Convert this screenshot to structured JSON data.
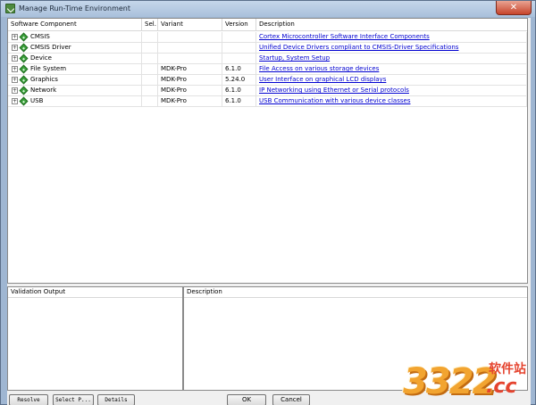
{
  "window": {
    "title": "Manage Run-Time Environment",
    "close_label": "✕"
  },
  "grid": {
    "columns": {
      "component": "Software Component",
      "sel": "Sel.",
      "variant": "Variant",
      "version": "Version",
      "description": "Description"
    },
    "rows": [
      {
        "expander": "+",
        "name": "CMSIS",
        "sel": "",
        "variant": "",
        "version": "",
        "description": "Cortex Microcontroller Software Interface Components"
      },
      {
        "expander": "+",
        "name": "CMSIS Driver",
        "sel": "",
        "variant": "",
        "version": "",
        "description": "Unified Device Drivers compliant to CMSIS-Driver Specifications"
      },
      {
        "expander": "+",
        "name": "Device",
        "sel": "",
        "variant": "",
        "version": "",
        "description": "Startup, System Setup"
      },
      {
        "expander": "+",
        "name": "File System",
        "sel": "",
        "variant": "MDK-Pro",
        "version": "6.1.0",
        "description": "File Access on various storage devices"
      },
      {
        "expander": "+",
        "name": "Graphics",
        "sel": "",
        "variant": "MDK-Pro",
        "version": "5.24.0",
        "description": "User Interface on graphical LCD displays"
      },
      {
        "expander": "+",
        "name": "Network",
        "sel": "",
        "variant": "MDK-Pro",
        "version": "6.1.0",
        "description": "IP Networking using Ethernet or Serial protocols"
      },
      {
        "expander": "+",
        "name": "USB",
        "sel": "",
        "variant": "MDK-Pro",
        "version": "6.1.0",
        "description": "USB Communication with various device classes"
      }
    ]
  },
  "validation": {
    "output_header": "Validation Output",
    "description_header": "Description"
  },
  "buttons": {
    "resolve": "Resolve",
    "select_packs": "Select P...",
    "details": "Details",
    "ok": "OK",
    "cancel": "Cancel"
  },
  "watermark": {
    "number": "3322",
    "site": "软件站",
    "domain": ".cc"
  },
  "icons": {
    "app": "rte-app-icon",
    "expand": "plus-box-icon",
    "component": "green-diamond-icon",
    "grip": "resize-grip-icon"
  },
  "colors": {
    "link": "#0000d0",
    "component_icon": "#3aa13a",
    "title_bar": "#a9c0db",
    "close_button": "#c7442b"
  }
}
